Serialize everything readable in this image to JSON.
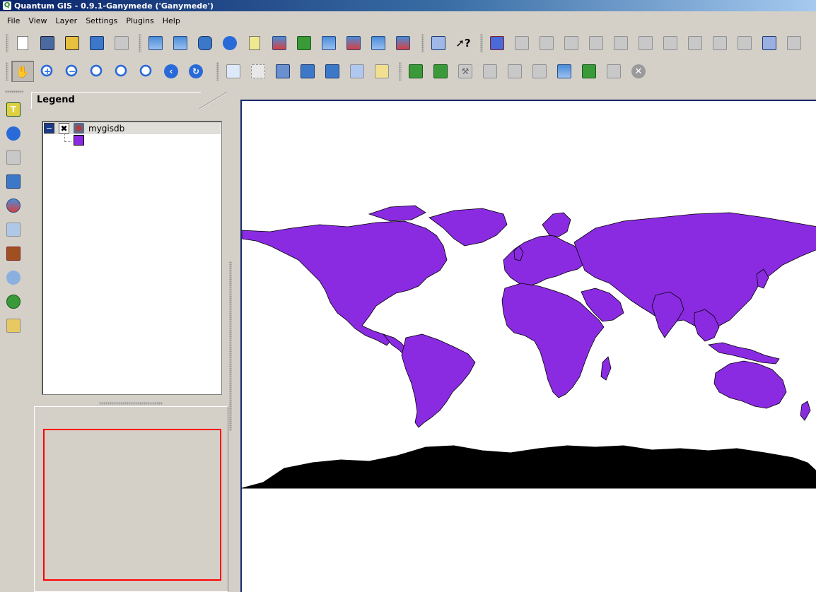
{
  "window": {
    "title": "Quantum GIS - 0.9.1-Ganymede ('Ganymede')",
    "app_icon": "Q"
  },
  "menubar": {
    "items": [
      "File",
      "View",
      "Layer",
      "Settings",
      "Plugins",
      "Help"
    ]
  },
  "toolbar_file": {
    "icons": [
      "new-project-icon",
      "save-project-icon",
      "save-as-icon",
      "open-project-icon",
      "print-icon"
    ]
  },
  "toolbar_layers": {
    "icons": [
      "add-raster-icon",
      "add-wms-icon",
      "add-postgis-icon",
      "add-vector-icon",
      "new-vector-icon",
      "remove-layer-icon",
      "refresh-icon",
      "show-all-icon",
      "hide-all-icon",
      "overview-add-icon",
      "overview-remove-icon"
    ]
  },
  "toolbar_help": {
    "icons": [
      "help-contents-icon",
      "whats-this-icon"
    ]
  },
  "toolbar_digitize": {
    "icons": [
      "toggle-editing-icon",
      "capture-point-icon",
      "capture-line-icon",
      "capture-polygon-icon",
      "delete-selected-icon",
      "add-ring-icon",
      "add-island-icon",
      "move-vertex-icon",
      "add-vertex-icon",
      "delete-vertex-icon",
      "split-features-icon",
      "copy-features-icon",
      "paste-features-icon"
    ]
  },
  "toolbar_nav": {
    "icons": [
      "pan-icon",
      "zoom-in-icon",
      "zoom-out-icon",
      "zoom-full-icon",
      "zoom-selection-icon",
      "zoom-layer-icon",
      "zoom-last-icon",
      "refresh-map-icon"
    ]
  },
  "toolbar_attrs": {
    "icons": [
      "identify-icon",
      "select-icon",
      "open-table-icon",
      "measure-line-icon",
      "measure-area-icon",
      "show-bookmarks-icon",
      "new-bookmark-icon"
    ]
  },
  "toolbar_plugins": {
    "icons": [
      "grass-open-mapset-icon",
      "grass-new-mapset-icon",
      "grass-tools-icon",
      "grass-edit-icon",
      "grass-region-icon",
      "grass-display-region-icon",
      "grass-vector-icon",
      "grass-raster-icon",
      "grass-module-icon",
      "close-plugin-icon"
    ]
  },
  "side_toolbar": {
    "icons": [
      "plugin-text-icon",
      "globe-plugin-icon",
      "gps-plugin-icon",
      "delimited-text-icon",
      "georeferencer-icon",
      "quick-print-icon",
      "scale-bar-icon",
      "copyright-icon",
      "north-arrow-icon",
      "spit-icon"
    ]
  },
  "legend": {
    "title": "Legend",
    "layers": [
      {
        "name": "mygisdb",
        "visible": true,
        "symbol_color": "#8a2be2"
      }
    ]
  },
  "overview": {
    "extent_color": "#ff0000"
  },
  "map": {
    "land_color": "#8a2be2",
    "antarctica_color": "#000000",
    "background": "#ffffff"
  }
}
